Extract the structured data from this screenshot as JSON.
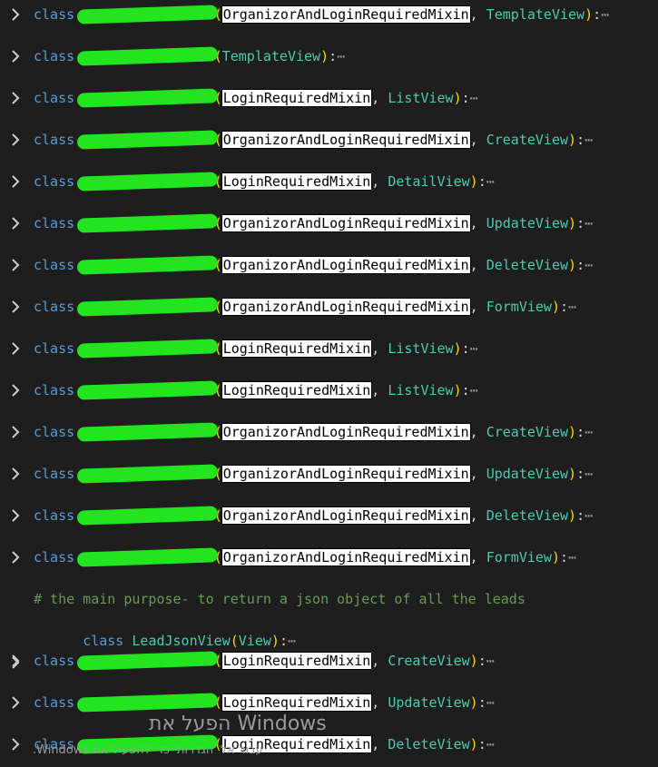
{
  "keyword": "class",
  "fold_glyph": "⋯",
  "lines": [
    {
      "mixin": "OrganizorAndLoginRequiredMixin",
      "base": "TemplateView",
      "tail": "):"
    },
    {
      "mixin": "",
      "base": "TemplateView",
      "tail": "):"
    },
    {
      "mixin": "LoginRequiredMixin",
      "base": "ListView",
      "tail": "): "
    },
    {
      "mixin": "OrganizorAndLoginRequiredMixin",
      "base": "CreateView",
      "tail": "):"
    },
    {
      "mixin": "LoginRequiredMixin",
      "base": "DetailView",
      "tail": "):"
    },
    {
      "mixin": "OrganizorAndLoginRequiredMixin",
      "base": "UpdateView",
      "tail": "):"
    },
    {
      "mixin": "OrganizorAndLoginRequiredMixin",
      "base": "DeleteView",
      "tail": "):"
    },
    {
      "mixin": "OrganizorAndLoginRequiredMixin",
      "base": "FormView",
      "tail": "):"
    },
    {
      "mixin": "LoginRequiredMixin",
      "base": "ListView",
      "tail": "):"
    },
    {
      "mixin": "LoginRequiredMixin",
      "base": "ListView",
      "tail": "):"
    },
    {
      "mixin": "OrganizorAndLoginRequiredMixin",
      "base": "CreateView",
      "tail": "):"
    },
    {
      "mixin": "OrganizorAndLoginRequiredMixin",
      "base": "UpdateView",
      "tail": "):"
    },
    {
      "mixin": "OrganizorAndLoginRequiredMixin",
      "base": "DeleteView",
      "tail": "):"
    },
    {
      "mixin": "OrganizorAndLoginRequiredMixin",
      "base": "FormView",
      "tail": "):"
    }
  ],
  "comment": "# the main purpose- to return a json object of all the leads",
  "json_view": {
    "name": "LeadJsonView",
    "base": "View",
    "tail": "):"
  },
  "tail_lines": [
    {
      "mixin": "LoginRequiredMixin",
      "base": "CreateView",
      "tail": "):"
    },
    {
      "mixin": "LoginRequiredMixin",
      "base": "UpdateView",
      "tail": "):"
    },
    {
      "mixin": "LoginRequiredMixin",
      "base": "DeleteView",
      "tail": "):"
    }
  ],
  "watermark": {
    "title": "הפעל את Windows",
    "subtitle": ".Windows עבור אל 'הגדרות' כדי להפעיל את"
  },
  "colors": {
    "background": "#1e1e1e",
    "keyword": "#569cd6",
    "class_name": "#4ec9b0",
    "paren": "#ffd700",
    "comment": "#6a9955",
    "redaction": "#22e51f"
  }
}
